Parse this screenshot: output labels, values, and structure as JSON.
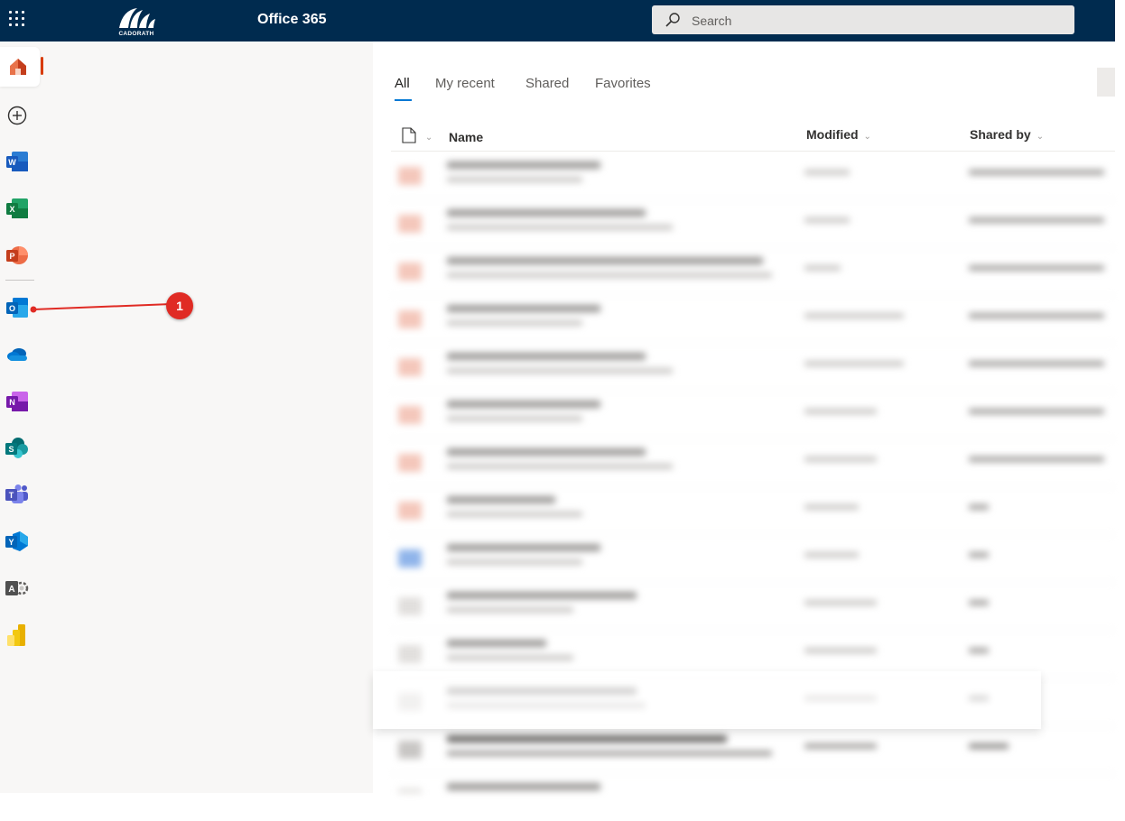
{
  "header": {
    "logo_text": "CADORATH",
    "app_title": "Office 365",
    "search_placeholder": "Search"
  },
  "rail": {
    "items": [
      {
        "name": "Home",
        "icon": "home-icon",
        "active": true
      },
      {
        "name": "Create",
        "icon": "add-circle-icon"
      },
      {
        "name": "Word",
        "icon": "word-icon",
        "letter": "W"
      },
      {
        "name": "Excel",
        "icon": "excel-icon",
        "letter": "X"
      },
      {
        "name": "PowerPoint",
        "icon": "powerpoint-icon",
        "letter": "P"
      },
      {
        "name": "Outlook",
        "icon": "outlook-icon",
        "letter": "O"
      },
      {
        "name": "OneDrive",
        "icon": "onedrive-icon"
      },
      {
        "name": "OneNote",
        "icon": "onenote-icon",
        "letter": "N"
      },
      {
        "name": "SharePoint",
        "icon": "sharepoint-icon",
        "letter": "S"
      },
      {
        "name": "Teams",
        "icon": "teams-icon",
        "letter": "T"
      },
      {
        "name": "Yammer",
        "icon": "yammer-icon",
        "letter": "Y"
      },
      {
        "name": "Admin",
        "icon": "admin-icon",
        "letter": "A"
      },
      {
        "name": "Power BI",
        "icon": "powerbi-icon"
      }
    ]
  },
  "callout": {
    "label": "1"
  },
  "tabs": [
    "All",
    "My recent",
    "Shared",
    "Favorites"
  ],
  "columns": {
    "name": "Name",
    "modified": "Modified",
    "shared_by": "Shared by"
  },
  "colors": {
    "topbar": "#002b4f",
    "accent": "#0078d4",
    "active_indicator": "#d83b01",
    "callout": "#e02b24"
  }
}
